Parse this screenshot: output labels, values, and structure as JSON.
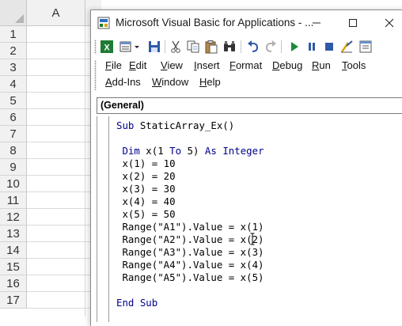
{
  "excel": {
    "column_header": "A",
    "row_numbers": [
      "1",
      "2",
      "3",
      "4",
      "5",
      "6",
      "7",
      "8",
      "9",
      "10",
      "11",
      "12",
      "13",
      "14",
      "15",
      "16",
      "17"
    ]
  },
  "window": {
    "title": "Microsoft Visual Basic for Applications - ...",
    "controls": {
      "minimize": "—",
      "maximize": "☐",
      "close": "✕"
    }
  },
  "toolbar": {
    "buttons": [
      "view-excel-icon",
      "insert-module-icon",
      "save-icon",
      "cut-icon",
      "copy-icon",
      "paste-icon",
      "find-icon",
      "undo-icon",
      "redo-icon",
      "run-icon",
      "break-icon",
      "reset-icon",
      "design-mode-icon"
    ]
  },
  "menu": {
    "row1": [
      "File",
      "Edit",
      "View",
      "Insert",
      "Format",
      "Debug",
      "Run",
      "Tools"
    ],
    "row2": [
      "Add-Ins",
      "Window",
      "Help"
    ]
  },
  "object_box": {
    "value": "(General)"
  },
  "code": {
    "keyword_color": "#00008b",
    "lines": [
      {
        "parts": [
          {
            "t": "Sub",
            "kw": true
          },
          {
            "t": " StaticArray_Ex()"
          }
        ]
      },
      {
        "parts": [
          {
            "t": ""
          }
        ]
      },
      {
        "parts": [
          {
            "t": " Dim",
            "kw": true
          },
          {
            "t": " x(1 "
          },
          {
            "t": "To",
            "kw": true
          },
          {
            "t": " 5) "
          },
          {
            "t": "As",
            "kw": true
          },
          {
            "t": " "
          },
          {
            "t": "Integer",
            "kw": true
          }
        ]
      },
      {
        "parts": [
          {
            "t": " x(1) = 10"
          }
        ]
      },
      {
        "parts": [
          {
            "t": " x(2) = 20"
          }
        ]
      },
      {
        "parts": [
          {
            "t": " x(3) = 30"
          }
        ]
      },
      {
        "parts": [
          {
            "t": " x(4) = 40"
          }
        ]
      },
      {
        "parts": [
          {
            "t": " x(5) = 50"
          }
        ]
      },
      {
        "parts": [
          {
            "t": " Range(\"A1\").Value = x(1)"
          }
        ]
      },
      {
        "parts": [
          {
            "t": " Range(\"A2\").Value = x(2)"
          }
        ]
      },
      {
        "parts": [
          {
            "t": " Range(\"A3\").Value = x(3)"
          }
        ]
      },
      {
        "parts": [
          {
            "t": " Range(\"A4\").Value = x(4)"
          }
        ]
      },
      {
        "parts": [
          {
            "t": " Range(\"A5\").Value = x(5)"
          }
        ]
      },
      {
        "parts": [
          {
            "t": ""
          }
        ]
      },
      {
        "parts": [
          {
            "t": "End Sub",
            "kw": true
          }
        ]
      }
    ]
  }
}
